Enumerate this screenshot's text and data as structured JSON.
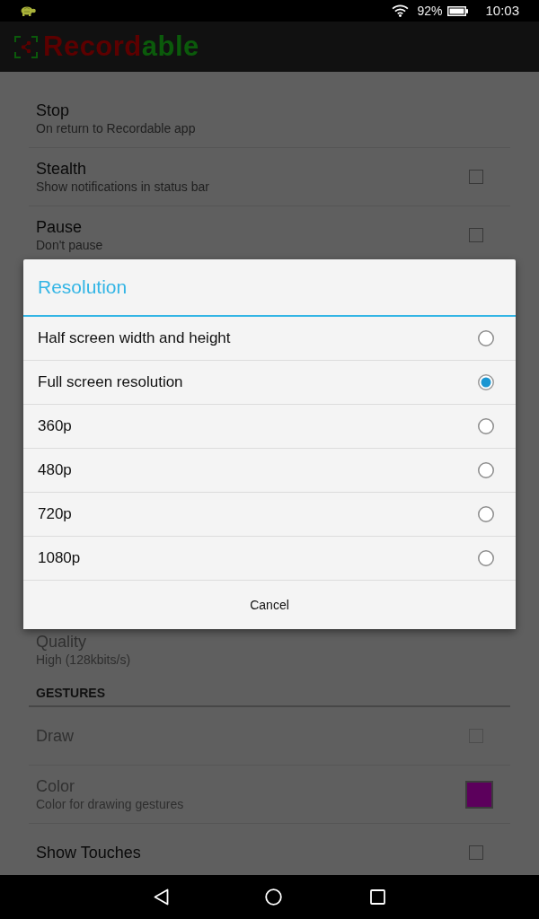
{
  "status_bar": {
    "battery_percent": "92%",
    "time": "10:03"
  },
  "app_bar": {
    "logo_parts": [
      {
        "text": "Record",
        "color": "#5c0000"
      },
      {
        "text": "able",
        "color": "#0b5a0b"
      }
    ]
  },
  "settings_top": [
    {
      "kind": "item",
      "title": "Stop",
      "summary": "On return to Recordable app",
      "disabled": false
    },
    {
      "kind": "checkbox",
      "title": "Stealth",
      "summary": "Show notifications in status bar",
      "checked": false,
      "disabled": false
    },
    {
      "kind": "checkbox",
      "title": "Pause",
      "summary": "Don't pause",
      "checked": false,
      "disabled": false
    }
  ],
  "settings_bottom": [
    {
      "kind": "item",
      "title": "Quality",
      "summary": "High (128kbits/s)",
      "disabled": true
    },
    {
      "kind": "header",
      "title": "GESTURES"
    },
    {
      "kind": "checkbox",
      "title": "Draw",
      "checked": false,
      "disabled": true
    },
    {
      "kind": "color",
      "title": "Color",
      "summary": "Color for drawing gestures",
      "color": "#5c005c",
      "disabled": true
    },
    {
      "kind": "checkbox",
      "title": "Show Touches",
      "checked": false,
      "disabled": false
    }
  ],
  "dialog": {
    "title": "Resolution",
    "options": [
      {
        "label": "Half screen width and height",
        "selected": false
      },
      {
        "label": "Full screen resolution",
        "selected": true
      },
      {
        "label": "360p",
        "selected": false
      },
      {
        "label": "480p",
        "selected": false
      },
      {
        "label": "720p",
        "selected": false
      },
      {
        "label": "1080p",
        "selected": false
      }
    ],
    "cancel": "Cancel"
  }
}
